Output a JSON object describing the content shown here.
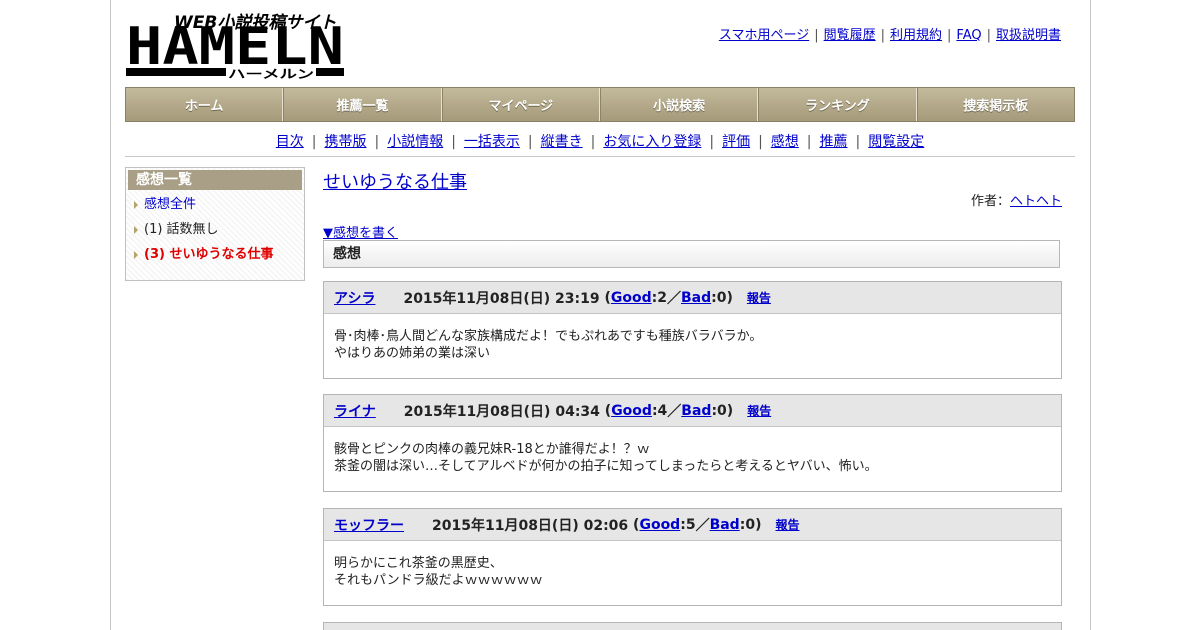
{
  "header": {
    "logo_text": "HAMELN",
    "logo_tagline": "WEB小説投稿サイト",
    "logo_kana": "ハーメルン",
    "top_links": [
      "スマホ用ページ",
      "閲覧履歴",
      "利用規約",
      "FAQ",
      "取扱説明書"
    ]
  },
  "main_nav": [
    "ホーム",
    "推薦一覧",
    "マイページ",
    "小説検索",
    "ランキング",
    "捜索掲示板"
  ],
  "sub_nav": [
    "目次",
    "携帯版",
    "小説情報",
    "一括表示",
    "縦書き",
    "お気に入り登録",
    "評価",
    "感想",
    "推薦",
    "閲覧設定"
  ],
  "sidebar": {
    "title": "感想一覧",
    "items": [
      {
        "label": "感想全件",
        "state": "link"
      },
      {
        "label": "(1) 話数無し",
        "state": "plain"
      },
      {
        "label": "(3) せいゆうなる仕事",
        "state": "current"
      }
    ]
  },
  "novel": {
    "title": "せいゆうなる仕事",
    "author_label": "作者：",
    "author": "ヘトヘト",
    "write_link": "▼感想を書く",
    "section_title": "感想"
  },
  "comments": [
    {
      "name": "アシラ",
      "date": "2015年11月08日(日) 23:19",
      "good_label": "Good",
      "good": "2",
      "bad_label": "Bad",
      "bad": "0",
      "report": "報告",
      "body": [
        "骨･肉棒･鳥人間どんな家族構成だよ！でもぷれあですも種族バラバラか。",
        "やはりあの姉弟の業は深い"
      ]
    },
    {
      "name": "ライナ",
      "date": "2015年11月08日(日) 04:34",
      "good_label": "Good",
      "good": "4",
      "bad_label": "Bad",
      "bad": "0",
      "report": "報告",
      "body": [
        "骸骨とピンクの肉棒の義兄妹R-18とか誰得だよ！？ｗ",
        "茶釜の闇は深い…そしてアルベドが何かの拍子に知ってしまったらと考えるとヤバい、怖い。"
      ]
    },
    {
      "name": "モッフラー",
      "date": "2015年11月08日(日) 02:06",
      "good_label": "Good",
      "good": "5",
      "bad_label": "Bad",
      "bad": "0",
      "report": "報告",
      "body": [
        "明らかにこれ茶釜の黒歴史、",
        "それもパンドラ級だよｗｗｗｗｗｗ"
      ]
    }
  ]
}
